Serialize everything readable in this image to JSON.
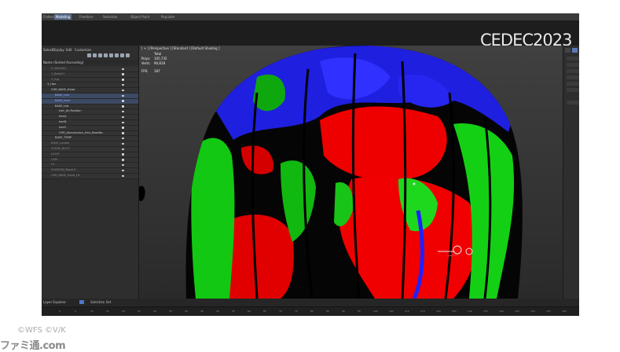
{
  "workspace_tabs": [
    "Flatten",
    "Modeling",
    "Freeform",
    "Selection",
    "Object Paint",
    "Populate"
  ],
  "logo": {
    "text": "CEDEC2023"
  },
  "explorer": {
    "menu": [
      "Select",
      "Display",
      "Edit",
      "Customize"
    ],
    "filter_text": "Name (Sorted Ascending)",
    "rows": [
      {
        "label": "0 (default)",
        "level": 2,
        "state": "dim"
      },
      {
        "label": "1_Body01",
        "level": 2,
        "state": "dim"
      },
      {
        "label": "2_Rig",
        "level": 2,
        "state": "dim"
      },
      {
        "label": "3_Hair",
        "level": 1,
        "state": "normal"
      },
      {
        "label": "CHR_BASE_Head",
        "level": 2,
        "state": "normal"
      },
      {
        "label": "BASE_hair",
        "level": 3,
        "state": "sel"
      },
      {
        "label": "BASE_face",
        "level": 3,
        "state": "sel"
      },
      {
        "label": "BASE_hat",
        "level": 3,
        "state": "normal"
      },
      {
        "label": "hair_Ah.Position",
        "level": 4,
        "state": "normal"
      },
      {
        "label": "hairA",
        "level": 4,
        "state": "normal"
      },
      {
        "label": "hairB",
        "level": 4,
        "state": "normal"
      },
      {
        "label": "hairC",
        "level": 4,
        "state": "normal"
      },
      {
        "label": "CHR_Ahavarrsion_Hair_BaseNo",
        "level": 4,
        "state": "normal"
      },
      {
        "label": "BASE_TEMP",
        "level": 3,
        "state": "normal"
      },
      {
        "label": "BASE_Ladder",
        "level": 2,
        "state": "dim"
      },
      {
        "label": "SCENE_ROOT",
        "level": 2,
        "state": "dim"
      },
      {
        "label": "LIGHT",
        "level": 2,
        "state": "dim"
      },
      {
        "label": "CAM",
        "level": 2,
        "state": "dim"
      },
      {
        "label": "FX",
        "level": 2,
        "state": "dim"
      },
      {
        "label": "SHADOW_BaseLit",
        "level": 2,
        "state": "dim"
      },
      {
        "label": "CHR_BASE_Hand_Lft",
        "level": 2,
        "state": "dim"
      }
    ],
    "footer_label": "Layer Explorer",
    "footer_selection": "Selection Set"
  },
  "viewport": {
    "label": "[ + ] [Perspective ] [Standard ] [Default Shading ]",
    "stats": {
      "heading": "Total",
      "polys_label": "Polys:",
      "polys": "105,735",
      "verts_label": "Verts:",
      "verts": "90,818",
      "fps_label": "FPS:",
      "fps": "187"
    }
  },
  "timeline": {
    "ticks": [
      "0",
      "5",
      "10",
      "15",
      "20",
      "25",
      "30",
      "35",
      "40",
      "45",
      "50",
      "55",
      "60",
      "65",
      "70",
      "75",
      "80",
      "85",
      "90",
      "95",
      "100",
      "105",
      "110",
      "115",
      "120",
      "125",
      "130",
      "135",
      "140",
      "145",
      "150",
      "155",
      "160"
    ]
  },
  "copyright": "©WFS ©V/K",
  "watermark": "ファミ通.com",
  "colors": {
    "hair_red": "#ff0000",
    "hair_green": "#00d000",
    "hair_blue": "#1a1aff",
    "selection": "#8fb0ff",
    "viewport_bg": "#3a3a3a"
  }
}
